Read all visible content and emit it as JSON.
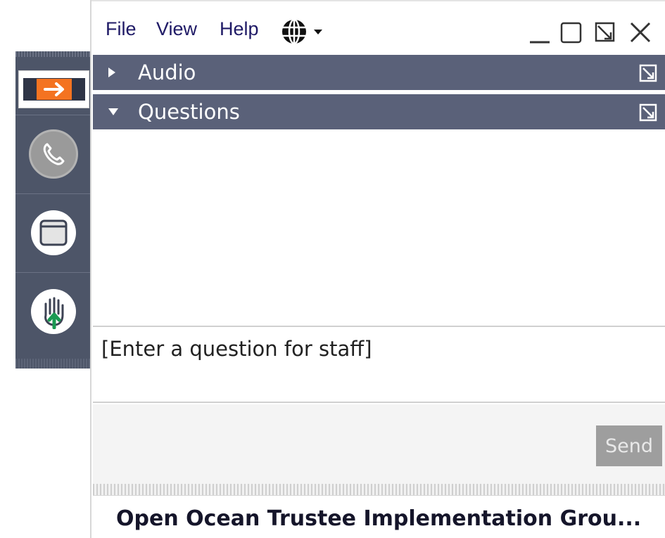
{
  "menu": {
    "file": "File",
    "view": "View",
    "help": "Help",
    "language_icon": "globe-icon"
  },
  "window_controls": [
    "minimize-icon",
    "maximize-icon",
    "popout-icon",
    "close-icon"
  ],
  "dock": {
    "items": [
      {
        "name": "collapse-panel-toggle",
        "icon": "arrow-right-icon",
        "color": "#f47321"
      },
      {
        "name": "audio-toggle",
        "icon": "phone-icon"
      },
      {
        "name": "window-toggle",
        "icon": "window-icon"
      },
      {
        "name": "raise-hand-toggle",
        "icon": "raise-hand-icon",
        "color": "#1a9a52"
      }
    ]
  },
  "panels": [
    {
      "label": "Audio",
      "state": "collapsed"
    },
    {
      "label": "Questions",
      "state": "expanded"
    }
  ],
  "questions": {
    "input_placeholder": "[Enter a question for staff]",
    "send_label": "Send"
  },
  "footer": {
    "title": "Open Ocean Trustee Implementation Grou..."
  },
  "colors": {
    "accent_orange": "#f47321",
    "header_bg": "#5a6179",
    "dock_bg": "#4d5568",
    "menu_text": "#1f1a66"
  }
}
